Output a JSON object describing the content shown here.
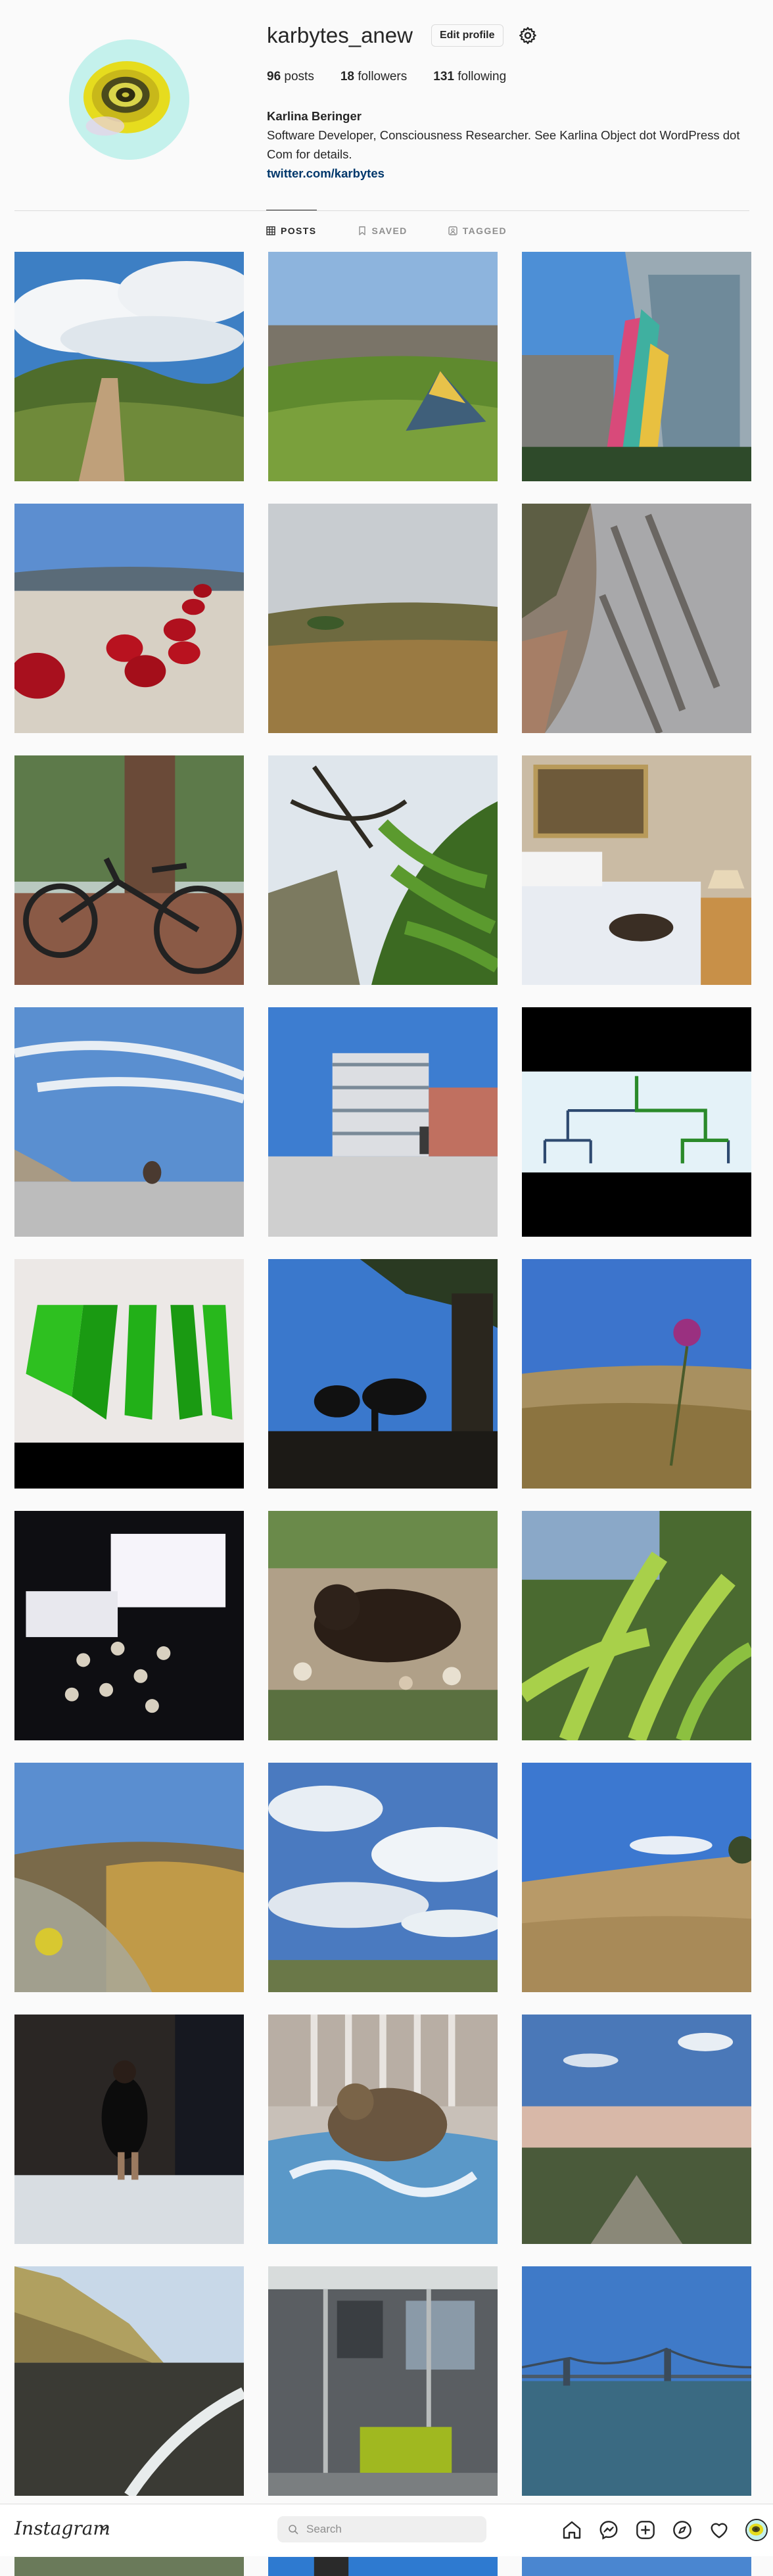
{
  "profile": {
    "username": "karbytes_anew",
    "edit_label": "Edit profile",
    "posts_count": "96",
    "posts_label": "posts",
    "followers_count": "18",
    "followers_label": "followers",
    "following_count": "131",
    "following_label": "following",
    "full_name": "Karlina Beringer",
    "bio": "Software Developer, Consciousness Researcher. See Karlina Object dot WordPress dot Com for details.",
    "link": "twitter.com/karbytes"
  },
  "tabs": [
    {
      "label": "POSTS",
      "icon": "grid-icon",
      "active": true
    },
    {
      "label": "SAVED",
      "icon": "bookmark-icon",
      "active": false
    },
    {
      "label": "TAGGED",
      "icon": "tag-icon",
      "active": false
    }
  ],
  "posts": [
    {
      "subject": "dirt trail through green hills under clouds"
    },
    {
      "subject": "tent on grassy hill above city"
    },
    {
      "subject": "colorful sculpture by glass building"
    },
    {
      "subject": "red glass orbs on sand"
    },
    {
      "subject": "dry hills under overcast sky"
    },
    {
      "subject": "close-up of rock face"
    },
    {
      "subject": "bicycle leaning on tree"
    },
    {
      "subject": "fern leaves and branches"
    },
    {
      "subject": "cat on bed with painting"
    },
    {
      "subject": "person on beach under wispy sky"
    },
    {
      "subject": "campus building and person"
    },
    {
      "subject": "tree diagram drawing"
    },
    {
      "subject": "green prism drawing"
    },
    {
      "subject": "cows silhouetted under tree"
    },
    {
      "subject": "purple thistle over meadow"
    },
    {
      "subject": "dried mushrooms with note"
    },
    {
      "subject": "cat lying on pebbles"
    },
    {
      "subject": "ferns in sunlight"
    },
    {
      "subject": "tent fabric over golden hills"
    },
    {
      "subject": "clouds over plain"
    },
    {
      "subject": "dry hillside under blue sky"
    },
    {
      "subject": "person in dark doorway"
    },
    {
      "subject": "cat on patterned cushion"
    },
    {
      "subject": "sunset over field"
    },
    {
      "subject": "beach cliffs and waves"
    },
    {
      "subject": "train car interior"
    },
    {
      "subject": "bridge over bay"
    }
  ],
  "nav": {
    "logo": "Instagram",
    "search_placeholder": "Search",
    "icons": [
      "home-icon",
      "messenger-icon",
      "new-post-icon",
      "explore-icon",
      "activity-heart-icon"
    ]
  },
  "colors": {
    "background": "#fafafa",
    "text": "#262626",
    "secondary": "#8e8e8e",
    "link": "#00376b",
    "border": "#dbdbdb"
  }
}
